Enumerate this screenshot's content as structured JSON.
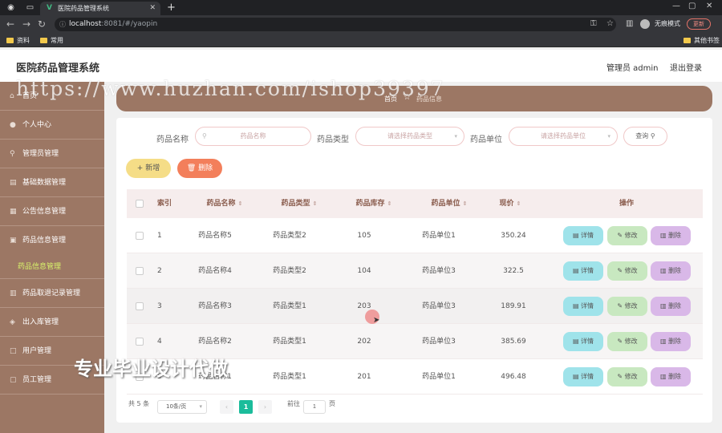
{
  "browser": {
    "tab_title": "医院药品管理系统",
    "url_host": "localhost",
    "url_port_path": ":8081/#/yaopin",
    "incognito_label": "无痕模式",
    "update_label": "更新",
    "bookmarks": [
      "资料",
      "常用"
    ],
    "other_bookmarks": "其他书签"
  },
  "app": {
    "title": "医院药品管理系统",
    "admin_label": "管理员 admin",
    "logout_label": "退出登录"
  },
  "sidebar": {
    "items": [
      {
        "label": "首页",
        "icon": "home-icon"
      },
      {
        "label": "个人中心",
        "icon": "user-icon"
      },
      {
        "label": "管理员管理",
        "icon": "admin-icon"
      },
      {
        "label": "基础数据管理",
        "icon": "data-icon"
      },
      {
        "label": "公告信息管理",
        "icon": "notice-icon"
      },
      {
        "label": "药品信息管理",
        "icon": "medicine-icon"
      },
      {
        "label": "药品取退记录管理",
        "icon": "record-icon"
      },
      {
        "label": "出入库管理",
        "icon": "warehouse-icon"
      },
      {
        "label": "用户管理",
        "icon": "users-icon"
      },
      {
        "label": "员工管理",
        "icon": "staff-icon"
      }
    ],
    "active_sub": "药品信息管理"
  },
  "breadcrumb": {
    "home": "首页",
    "current": "药品信息"
  },
  "filters": {
    "name_label": "药品名称",
    "name_placeholder": "药品名称",
    "type_label": "药品类型",
    "type_placeholder": "请选择药品类型",
    "unit_label": "药品单位",
    "unit_placeholder": "请选择药品单位",
    "query_label": "查询"
  },
  "actions": {
    "add_label": "新增",
    "delete_label": "删除"
  },
  "table": {
    "columns": [
      "索引",
      "药品名称",
      "药品类型",
      "药品库存",
      "药品单位",
      "现价",
      "操作"
    ],
    "row_actions": {
      "detail": "详情",
      "edit": "修改",
      "remove": "删除"
    },
    "rows": [
      {
        "index": "1",
        "name": "药品名称5",
        "type": "药品类型2",
        "stock": "105",
        "unit": "药品单位1",
        "price": "350.24"
      },
      {
        "index": "2",
        "name": "药品名称4",
        "type": "药品类型2",
        "stock": "104",
        "unit": "药品单位3",
        "price": "322.5"
      },
      {
        "index": "3",
        "name": "药品名称3",
        "type": "药品类型1",
        "stock": "203",
        "unit": "药品单位3",
        "price": "189.91"
      },
      {
        "index": "4",
        "name": "药品名称2",
        "type": "药品类型1",
        "stock": "202",
        "unit": "药品单位3",
        "price": "385.69"
      },
      {
        "index": "5",
        "name": "药品名称1",
        "type": "药品类型1",
        "stock": "201",
        "unit": "药品单位1",
        "price": "496.48"
      }
    ]
  },
  "pagination": {
    "total": "共 5 条",
    "page_size": "10条/页",
    "current_page": "1",
    "goto_label": "前往",
    "goto_value": "1",
    "page_suffix": "页"
  },
  "overlays": {
    "watermark_url": "https://www.huzhan.com/ishop39397",
    "watermark_text": "专业毕业设计代做"
  }
}
